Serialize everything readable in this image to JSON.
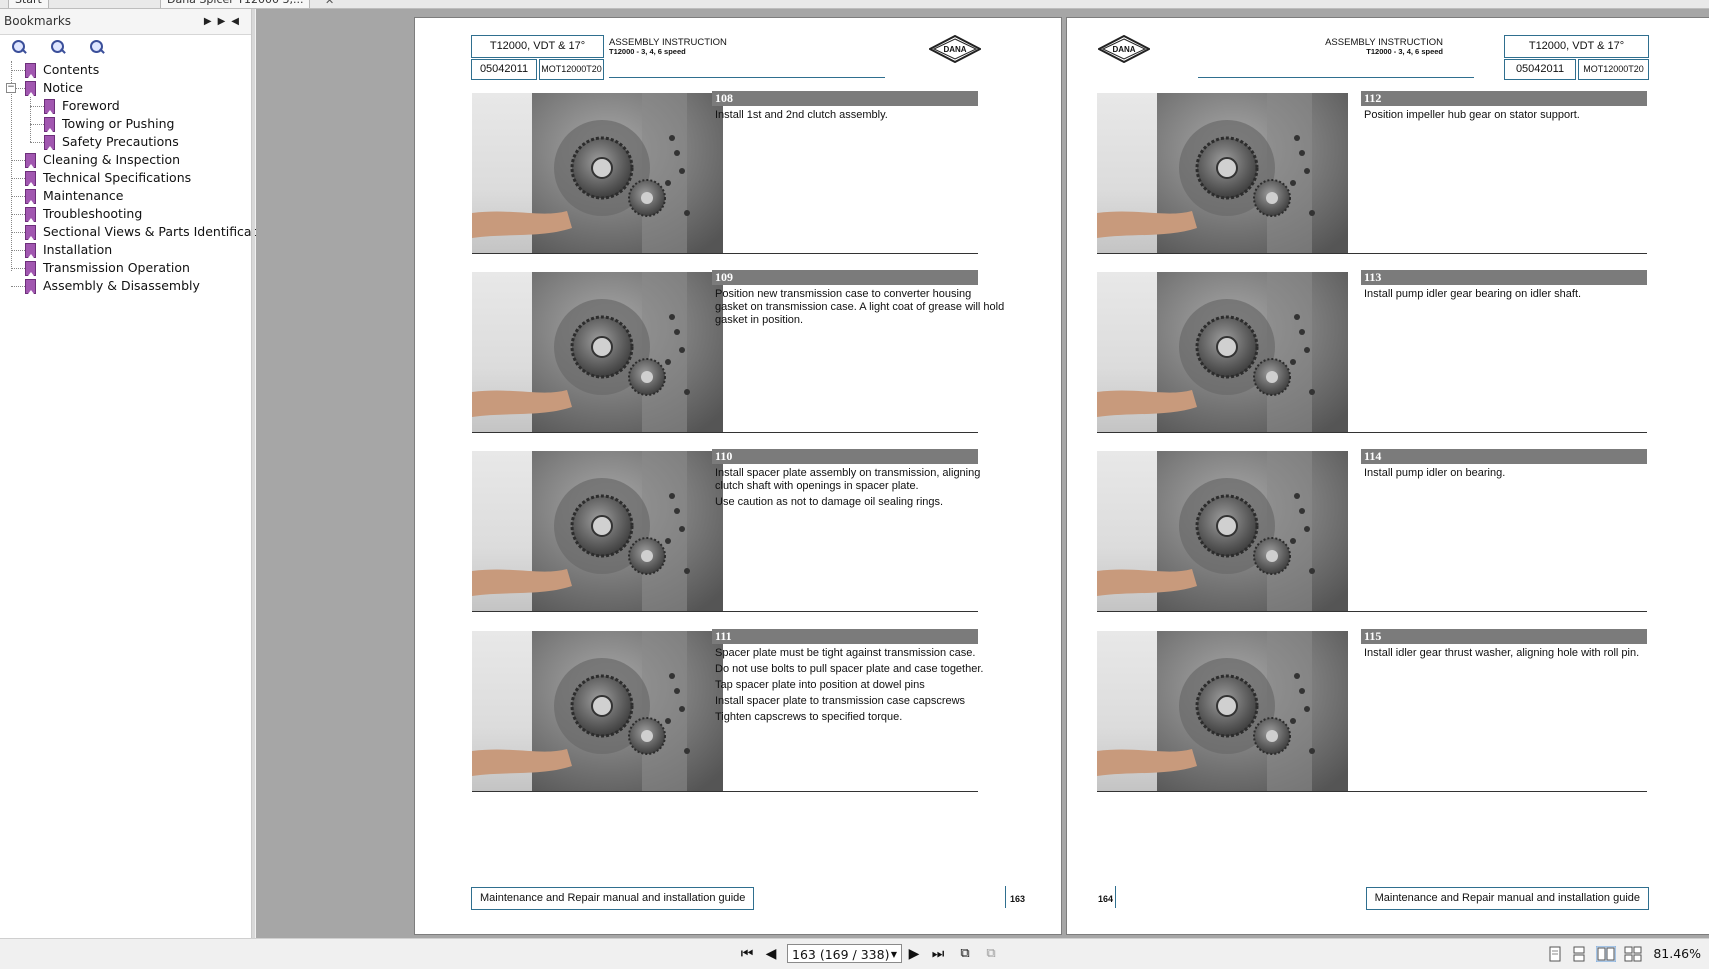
{
  "tabs": [
    {
      "label": "Start"
    },
    {
      "label": "Dana Spicer T12000 3,..."
    }
  ],
  "sidebar": {
    "title": "Bookmarks",
    "items": [
      {
        "label": "Contents"
      },
      {
        "label": "Notice"
      },
      {
        "label": "Foreword"
      },
      {
        "label": "Towing or Pushing"
      },
      {
        "label": "Safety Precautions"
      },
      {
        "label": "Cleaning & Inspection"
      },
      {
        "label": "Technical Specifications"
      },
      {
        "label": "Maintenance"
      },
      {
        "label": "Troubleshooting"
      },
      {
        "label": "Sectional Views & Parts Identification"
      },
      {
        "label": "Installation"
      },
      {
        "label": "Transmission Operation"
      },
      {
        "label": "Assembly & Disassembly"
      }
    ]
  },
  "header": {
    "model": "T12000, VDT & 17°",
    "doc_date": "05042011",
    "doc_code": "MOT12000T20",
    "section": "ASSEMBLY INSTRUCTION",
    "subsection": "T12000 - 3, 4, 6 speed",
    "logo_text": "DANA"
  },
  "left_page": {
    "number": "163",
    "footer": "Maintenance and Repair manual and installation guide",
    "steps": [
      {
        "num": "108",
        "lines": [
          "Install 1st and 2nd clutch assembly."
        ]
      },
      {
        "num": "109",
        "lines": [
          "Position new transmission case to converter housing gasket on transmission case. A light coat of grease will hold gasket in position."
        ]
      },
      {
        "num": "110",
        "lines": [
          "Install spacer plate assembly on transmission, aligning clutch shaft with openings in spacer plate.",
          "Use caution as not to damage oil sealing rings."
        ]
      },
      {
        "num": "111",
        "lines": [
          "Spacer plate must be tight against transmission case.",
          "Do not use bolts to pull spacer plate and case together.",
          "Tap spacer plate into position at dowel pins",
          " Install spacer plate to transmission case capscrews",
          "Tighten capscrews to specified torque."
        ]
      }
    ]
  },
  "right_page": {
    "number": "164",
    "footer": "Maintenance and Repair manual and installation guide",
    "steps": [
      {
        "num": "112",
        "lines": [
          "Position impeller hub gear on stator support."
        ]
      },
      {
        "num": "113",
        "lines": [
          "Install pump idler gear bearing on idler shaft."
        ]
      },
      {
        "num": "114",
        "lines": [
          "Install pump idler on bearing."
        ]
      },
      {
        "num": "115",
        "lines": [
          "Install idler gear thrust washer, aligning hole with roll pin."
        ]
      }
    ]
  },
  "statusbar": {
    "page_indicator": "163 (169 / 338)",
    "zoom": "81.46%"
  }
}
